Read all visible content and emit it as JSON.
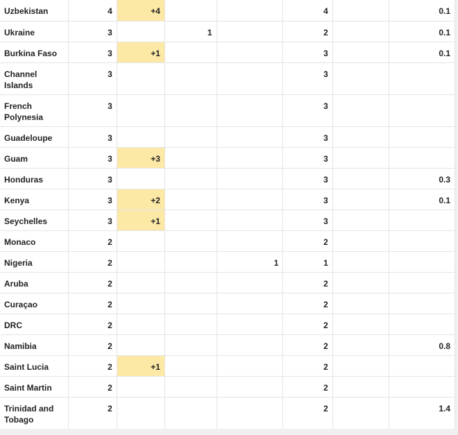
{
  "table": {
    "highlight_color": "#fde9a6",
    "rows": [
      {
        "country": "Uzbekistan",
        "total": "4",
        "new": "+4",
        "deaths": "",
        "new_deaths": "",
        "active": "4",
        "per_million": "0.1"
      },
      {
        "country": "Ukraine",
        "total": "3",
        "new": "",
        "deaths": "1",
        "new_deaths": "",
        "active": "2",
        "per_million": "0.1"
      },
      {
        "country": "Burkina Faso",
        "total": "3",
        "new": "+1",
        "deaths": "",
        "new_deaths": "",
        "active": "3",
        "per_million": "0.1"
      },
      {
        "country": "Channel Islands",
        "total": "3",
        "new": "",
        "deaths": "",
        "new_deaths": "",
        "active": "3",
        "per_million": ""
      },
      {
        "country": "French Polynesia",
        "total": "3",
        "new": "",
        "deaths": "",
        "new_deaths": "",
        "active": "3",
        "per_million": ""
      },
      {
        "country": "Guadeloupe",
        "total": "3",
        "new": "",
        "deaths": "",
        "new_deaths": "",
        "active": "3",
        "per_million": ""
      },
      {
        "country": "Guam",
        "total": "3",
        "new": "+3",
        "deaths": "",
        "new_deaths": "",
        "active": "3",
        "per_million": ""
      },
      {
        "country": "Honduras",
        "total": "3",
        "new": "",
        "deaths": "",
        "new_deaths": "",
        "active": "3",
        "per_million": "0.3"
      },
      {
        "country": "Kenya",
        "total": "3",
        "new": "+2",
        "deaths": "",
        "new_deaths": "",
        "active": "3",
        "per_million": "0.1"
      },
      {
        "country": "Seychelles",
        "total": "3",
        "new": "+1",
        "deaths": "",
        "new_deaths": "",
        "active": "3",
        "per_million": ""
      },
      {
        "country": "Monaco",
        "total": "2",
        "new": "",
        "deaths": "",
        "new_deaths": "",
        "active": "2",
        "per_million": ""
      },
      {
        "country": "Nigeria",
        "total": "2",
        "new": "",
        "deaths": "",
        "new_deaths": "1",
        "active": "1",
        "per_million": ""
      },
      {
        "country": "Aruba",
        "total": "2",
        "new": "",
        "deaths": "",
        "new_deaths": "",
        "active": "2",
        "per_million": ""
      },
      {
        "country": "Curaçao",
        "total": "2",
        "new": "",
        "deaths": "",
        "new_deaths": "",
        "active": "2",
        "per_million": ""
      },
      {
        "country": "DRC",
        "total": "2",
        "new": "",
        "deaths": "",
        "new_deaths": "",
        "active": "2",
        "per_million": ""
      },
      {
        "country": "Namibia",
        "total": "2",
        "new": "",
        "deaths": "",
        "new_deaths": "",
        "active": "2",
        "per_million": "0.8"
      },
      {
        "country": "Saint Lucia",
        "total": "2",
        "new": "+1",
        "deaths": "",
        "new_deaths": "",
        "active": "2",
        "per_million": ""
      },
      {
        "country": "Saint Martin",
        "total": "2",
        "new": "",
        "deaths": "",
        "new_deaths": "",
        "active": "2",
        "per_million": ""
      },
      {
        "country": "Trinidad and Tobago",
        "total": "2",
        "new": "",
        "deaths": "",
        "new_deaths": "",
        "active": "2",
        "per_million": "1.4"
      }
    ]
  }
}
